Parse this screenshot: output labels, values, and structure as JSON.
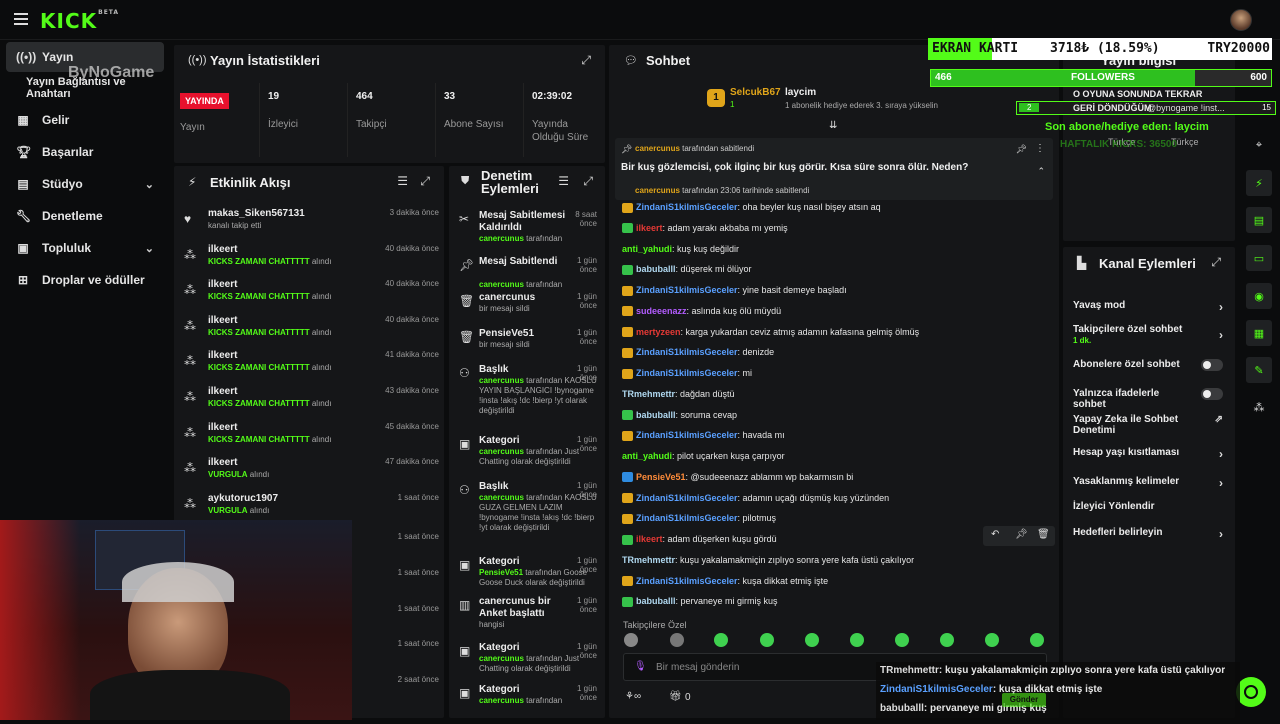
{
  "app": {
    "logo": "KICK",
    "logo_sup": "BETA"
  },
  "watermark": "ByNoGame",
  "sidebar": {
    "items": [
      {
        "label": "Yayın"
      },
      {
        "label": "Yayın Bağlantısı ve Anahtarı"
      },
      {
        "label": "Gelir"
      },
      {
        "label": "Başarılar"
      },
      {
        "label": "Stüdyo"
      },
      {
        "label": "Denetleme"
      },
      {
        "label": "Topluluk"
      },
      {
        "label": "Droplar ve ödüller"
      }
    ]
  },
  "stats": {
    "title": "Yayın İstatistikleri",
    "live": "YAYINDA",
    "live_label": "Yayın",
    "items": [
      {
        "value": "19",
        "label": "İzleyici"
      },
      {
        "value": "464",
        "label": "Takipçi"
      },
      {
        "value": "33",
        "label": "Abone Sayısı"
      },
      {
        "value": "02:39:02",
        "label": "Yayında Olduğu Süre"
      }
    ]
  },
  "activity": {
    "title": "Etkinlik Akışı",
    "rows": [
      {
        "name": "makas_Siken567131",
        "sub_pre": "kanalı takip etti",
        "sub_b": "",
        "sub_post": "",
        "time": "3 dakika önce"
      },
      {
        "name": "ilkeert",
        "sub_pre": "",
        "sub_b": "KICKS ZAMANI CHATTTTT",
        "sub_post": " alındı",
        "time": "40 dakika önce"
      },
      {
        "name": "ilkeert",
        "sub_pre": "",
        "sub_b": "KICKS ZAMANI CHATTTTT",
        "sub_post": " alındı",
        "time": "40 dakika önce"
      },
      {
        "name": "ilkeert",
        "sub_pre": "",
        "sub_b": "KICKS ZAMANI CHATTTTT",
        "sub_post": " alındı",
        "time": "40 dakika önce"
      },
      {
        "name": "ilkeert",
        "sub_pre": "",
        "sub_b": "KICKS ZAMANI CHATTTTT",
        "sub_post": " alındı",
        "time": "41 dakika önce"
      },
      {
        "name": "ilkeert",
        "sub_pre": "",
        "sub_b": "KICKS ZAMANI CHATTTTT",
        "sub_post": " alındı",
        "time": "43 dakika önce"
      },
      {
        "name": "ilkeert",
        "sub_pre": "",
        "sub_b": "KICKS ZAMANI CHATTTTT",
        "sub_post": " alındı",
        "time": "45 dakika önce"
      },
      {
        "name": "ilkeert",
        "sub_pre": "",
        "sub_b": "VURGULA",
        "sub_post": " alındı",
        "time": "47 dakika önce"
      },
      {
        "name": "aykutoruc1907",
        "sub_pre": "",
        "sub_b": "VURGULA",
        "sub_post": " alındı",
        "time": "1 saat önce"
      }
    ],
    "more_times": [
      "1 saat önce",
      "1 saat önce",
      "1 saat önce",
      "1 saat önce",
      "2 saat önce"
    ]
  },
  "moderation": {
    "title1": "Denetim",
    "title2": "Eylemleri",
    "rows": [
      {
        "title": "Mesaj Sabitlemesi Kaldırıldı",
        "desc_b": "canercunus",
        "desc": " tarafından",
        "time": "8 saat önce"
      },
      {
        "title": "Mesaj Sabitlendi",
        "desc_b": "canercunus",
        "desc": " tarafından",
        "time": "1 gün önce"
      },
      {
        "title": "canercunus",
        "desc_b": "",
        "desc": "bir mesajı sildi",
        "time": "1 gün önce"
      },
      {
        "title": "PensieVe51",
        "desc_b": "",
        "desc": "bir mesajı sildi",
        "time": "1 gün önce"
      },
      {
        "title": "Başlık",
        "desc_b": "canercunus",
        "desc": " tarafından KAOSLU YAYIN BAŞLANGICI !bynogame !insta !akış !dc !bierp !yt olarak değiştirildi",
        "time": "1 gün önce"
      },
      {
        "title": "Kategori",
        "desc_b": "canercunus",
        "desc": " tarafından Just Chatting olarak değiştirildi",
        "time": "1 gün önce"
      },
      {
        "title": "Başlık",
        "desc_b": "canercunus",
        "desc": " tarafından KAOSLU GUZA GELMEN LAZIM !bynogame !insta !akış !dc !bierp !yt olarak değiştirildi",
        "time": "1 gün önce"
      },
      {
        "title": "Kategori",
        "desc_b": "PensieVe51",
        "desc": " tarafından Goose Goose Duck olarak değiştirildi",
        "time": "1 gün önce"
      },
      {
        "title": "canercunus bir Anket başlattı",
        "desc_b": "",
        "desc": "hangisi",
        "time": "1 gün önce"
      },
      {
        "title": "Kategori",
        "desc_b": "canercunus",
        "desc": " tarafından Just Chatting olarak değiştirildi",
        "time": "1 gün önce"
      },
      {
        "title": "Kategori",
        "desc_b": "canercunus",
        "desc": " tarafından",
        "time": "1 gün önce"
      }
    ]
  },
  "chat": {
    "title": "Sohbet",
    "gift_user": "SelcukB67",
    "gift_target": "laycim",
    "gift_count": "1",
    "gift_text": "1 abonelik hediye ederek 3. sıraya yükselin",
    "pinned_by": "canercunus",
    "pinned_by_suffix": " tarafından sabitlendi",
    "pinned_msg": "Bir kuş gözlemcisi, çok ilginç bir kuş görür. Kısa süre sonra ölür. Neden?",
    "pinned_footer_user": "canercunus",
    "pinned_footer": " tarafından 23:06 tarihinde sabitlendi",
    "messages": [
      {
        "user": "ZindaniS1kilmisGeceler",
        "color": "#5aa0ff",
        "badge": "gold",
        "text": ": oha beyler kuş nasıl bişey atsın aq"
      },
      {
        "user": "ilkeert",
        "color": "#e53935",
        "badge": "green",
        "text": ": adam yarakı akbaba mı yemiş"
      },
      {
        "user": "anti_yahudi",
        "color": "#53fc18",
        "badge": "",
        "text": ": kuş kuş değildir"
      },
      {
        "user": "babuballl",
        "color": "#b0d8f0",
        "badge": "green",
        "text": ": düşerek mi ölüyor"
      },
      {
        "user": "ZindaniS1kilmisGeceler",
        "color": "#5aa0ff",
        "badge": "gold",
        "text": ": yine basit demeye başladı"
      },
      {
        "user": "sudeeenazz",
        "color": "#b35cff",
        "badge": "gold",
        "text": ": aslında kuş ölü müydü"
      },
      {
        "user": "mertyzeen",
        "color": "#e53935",
        "badge": "gold",
        "text": ": karga yukardan ceviz atmış adamın kafasına gelmiş ölmüş"
      },
      {
        "user": "ZindaniS1kilmisGeceler",
        "color": "#5aa0ff",
        "badge": "gold",
        "text": ": denizde"
      },
      {
        "user": "ZindaniS1kilmisGeceler",
        "color": "#5aa0ff",
        "badge": "gold",
        "text": ": mi"
      },
      {
        "user": "TRmehmettr",
        "color": "#b0d8f0",
        "badge": "",
        "text": ": dağdan düştü"
      },
      {
        "user": "babuballl",
        "color": "#b0d8f0",
        "badge": "green",
        "text": ": soruma cevap"
      },
      {
        "user": "ZindaniS1kilmisGeceler",
        "color": "#5aa0ff",
        "badge": "gold",
        "text": ": havada mı"
      },
      {
        "user": "anti_yahudi",
        "color": "#53fc18",
        "badge": "",
        "text": ": pilot uçarken kuşa çarpıyor"
      },
      {
        "user": "PensieVe51",
        "color": "#ff8c3a",
        "badge": "blue",
        "text": ": @sudeeenazz ablamm wp bakarmısın bi"
      },
      {
        "user": "ZindaniS1kilmisGeceler",
        "color": "#5aa0ff",
        "badge": "gold",
        "text": ": adamın uçağı düşmüş kuş yüzünden"
      },
      {
        "user": "ZindaniS1kilmisGeceler",
        "color": "#5aa0ff",
        "badge": "gold",
        "text": ": pilotmuş"
      },
      {
        "user": "ilkeert",
        "color": "#e53935",
        "badge": "green",
        "text": ": adam düşerken kuşu gördü"
      },
      {
        "user": "TRmehmettr",
        "color": "#b0d8f0",
        "badge": "",
        "text": ": kuşu yakalamakmiçin zıplıyo sonra yere kafa üstü çakılıyor"
      },
      {
        "user": "ZindaniS1kilmisGeceler",
        "color": "#5aa0ff",
        "badge": "gold",
        "text": ": kuşa dikkat etmiş işte"
      },
      {
        "user": "babuballl",
        "color": "#b0d8f0",
        "badge": "green",
        "text": ": pervaneye mi girmiş kuş"
      }
    ],
    "followers_only": "Takipçilere Özel",
    "input_placeholder": "Bir mesaj gönderin",
    "count": "0",
    "send": "Gönder"
  },
  "channel_info": {
    "title": "Yayın bilgisi",
    "lang1": "Türkçe",
    "lang2": "Türkçe"
  },
  "channel_actions": {
    "title": "Kanal Eylemleri",
    "items": [
      {
        "label": "Yavaş mod",
        "sub": "",
        "control": "chevron"
      },
      {
        "label": "Takipçilere özel sohbet",
        "sub": "1 dk.",
        "control": "chevron"
      },
      {
        "label": "Abonelere özel sohbet",
        "sub": "",
        "control": "toggle"
      },
      {
        "label": "Yalnızca ifadelerle sohbet",
        "sub": "",
        "control": "toggle"
      },
      {
        "label": "Yapay Zeka ile Sohbet Denetimi",
        "sub": "",
        "control": "external"
      },
      {
        "label": "Hesap yaşı kısıtlaması",
        "sub": "",
        "control": "chevron"
      },
      {
        "label": "Yasaklanmış kelimeler",
        "sub": "",
        "control": "chevron"
      },
      {
        "label": "İzleyici Yönlendir",
        "sub": "",
        "control": "none"
      },
      {
        "label": "Hedefleri belirleyin",
        "sub": "",
        "control": "chevron"
      }
    ]
  },
  "overlay": {
    "gpu_label": "EKRAN KARTI",
    "gpu_value": "3718₺ (18.59%)",
    "gpu_target": "TRY20000",
    "gpu_progress": 0.1859,
    "followers_count": "466",
    "followers_label": "FOLLOWERS",
    "followers_goal": "600",
    "followers_progress": 0.7767,
    "line1": "O OYUNA SONUNDA TEKRAR",
    "line2": "GERİ DÖNDÜĞÜM",
    "line2b": "@bynogame !inst...",
    "small_left": "2",
    "small_right": "15",
    "last_sub": "Son abone/hediye eden: laycim",
    "haftalik": "HAFTALIK KICKS: 36500",
    "chat_overlay": [
      {
        "user": "TRmehmettr",
        "text": ": kuşu yakalamakmiçin zıplıyo sonra yere kafa üstü çakılıyor"
      },
      {
        "user": "ZindaniS1kilmisGeceler",
        "text": ": kuşa dikkat etmiş işte"
      },
      {
        "user": "babuballl",
        "text": ": pervaneye mi girmiş kuş"
      }
    ]
  },
  "colors": {
    "accent": "#53fc18",
    "live": "#e8112d",
    "panel": "#151618"
  }
}
